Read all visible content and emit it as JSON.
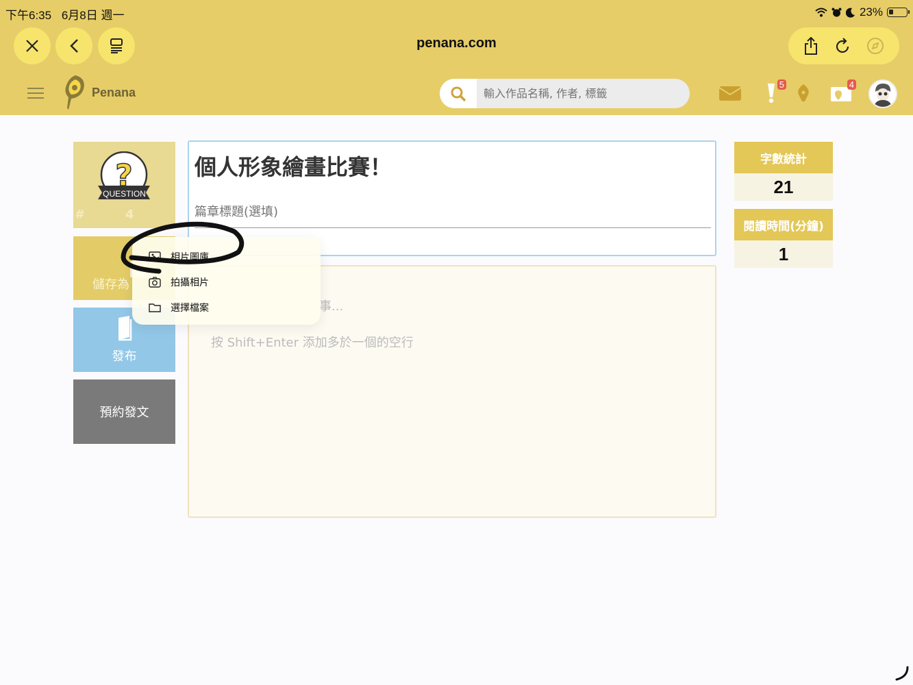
{
  "status_bar": {
    "time": "下午6:35",
    "date": "6月8日 週一",
    "battery": "23%"
  },
  "browser": {
    "url": "penana.com"
  },
  "site": {
    "logo_text": "Penana",
    "search_placeholder": "輸入作品名稱, 作者, 標籤",
    "badges": {
      "notifications": "5",
      "map": "4"
    }
  },
  "sidebar": {
    "question_label": "QUESTION",
    "question_hash": "#",
    "question_number": "4",
    "save_label": "儲存為",
    "publish_label": "發布",
    "schedule_label": "預約發文"
  },
  "editor": {
    "title": "個人形象繪畫比賽！",
    "chapter_placeholder": "篇章標題(選填)",
    "body_placeholder_1": "事...",
    "body_placeholder_2": "按 Shift+Enter 添加多於一個的空行"
  },
  "stats": {
    "word_count_label": "字數統計",
    "word_count_value": "21",
    "reading_time_label": "閱讀時間(分鐘)",
    "reading_time_value": "1"
  },
  "popup_menu": {
    "items": [
      "相片圖庫",
      "拍攝相片",
      "選擇檔案"
    ]
  },
  "colors": {
    "chrome": "#e6cd67",
    "button": "#f6e46d",
    "publish": "#92c7e7",
    "schedule": "#7a7a7a",
    "stat_header": "#e3c757"
  }
}
